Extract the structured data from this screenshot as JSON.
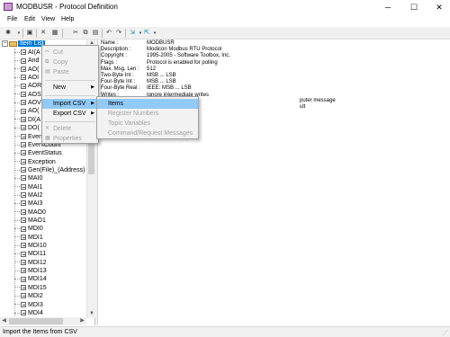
{
  "window": {
    "title": "MODBUSR - Protocol Definition",
    "minimize": "─",
    "maximize": "☐",
    "close": "✕"
  },
  "menubar": [
    "File",
    "Edit",
    "View",
    "Help"
  ],
  "toolbar": {
    "icons": [
      "new-icon",
      "save-icon",
      "delete-icon",
      "properties-icon",
      "cut-icon",
      "copy-icon",
      "paste-icon",
      "undo-icon",
      "redo-icon",
      "import-icon",
      "export-icon"
    ]
  },
  "tree": {
    "root": "Item List",
    "items": [
      "AI(A",
      "And",
      "AO(",
      "AOI",
      "AOR",
      "AOS",
      "AOV",
      "AO(",
      "DI(A",
      "DO(",
      "Event",
      "EventCount",
      "EventStatus",
      "Exception",
      "Gen(File)_(Address)",
      "MAI0",
      "MAI1",
      "MAI2",
      "MAI3",
      "MAO0",
      "MAO1",
      "MDI0",
      "MDI1",
      "MDI10",
      "MDI11",
      "MDI12",
      "MDI13",
      "MDI14",
      "MDI15",
      "MDI2",
      "MDI3",
      "MDI4"
    ]
  },
  "properties": [
    {
      "key": "Name :",
      "value": "MODBUSR"
    },
    {
      "key": "Description :",
      "value": "Modicon Modbus RTU Protocol"
    },
    {
      "key": "Copyright :",
      "value": "1995-2005 - Software Toolbox, Inc."
    },
    {
      "key": "Flags :",
      "value": "Protocol is enabled for polling"
    },
    {
      "key": "Max. Msg. Len :",
      "value": "512"
    },
    {
      "key": "Two-Byte Int :",
      "value": "MSB ... LSB"
    },
    {
      "key": "Four-Byte Int :",
      "value": "MSB ... LSB"
    },
    {
      "key": "Four-Byte Real :",
      "value": "IEEE: MSB ... LSB"
    },
    {
      "key": "Writes :",
      "value": "Ignore intermediate writes"
    }
  ],
  "property_tails": [
    "puter message",
    "ult"
  ],
  "context_menu": {
    "items": [
      {
        "label": "Cut",
        "disabled": true,
        "icon": "✂"
      },
      {
        "label": "Copy",
        "disabled": true,
        "icon": "⧉"
      },
      {
        "label": "Paste",
        "disabled": true,
        "icon": "▤"
      },
      {
        "label": "New",
        "disabled": false,
        "submenu": true
      },
      {
        "label": "Import CSV",
        "disabled": false,
        "submenu": true,
        "hover": true
      },
      {
        "label": "Export CSV",
        "disabled": false,
        "submenu": true
      },
      {
        "label": "Delete",
        "disabled": true,
        "icon": "✕"
      },
      {
        "label": "Properties",
        "disabled": true,
        "icon": "▦"
      }
    ]
  },
  "import_submenu": {
    "items": [
      {
        "label": "Items",
        "hover": true,
        "disabled": false
      },
      {
        "label": "Register Numbers",
        "disabled": true
      },
      {
        "label": "Topic Variables",
        "disabled": true
      },
      {
        "label": "Command/Request Messages",
        "disabled": true
      }
    ]
  },
  "status": {
    "text": "Import the Items from CSV"
  },
  "colors": {
    "selection": "#0078d7",
    "menu_hover": "#91c9f7",
    "disabled_text": "#a0a0a0"
  }
}
